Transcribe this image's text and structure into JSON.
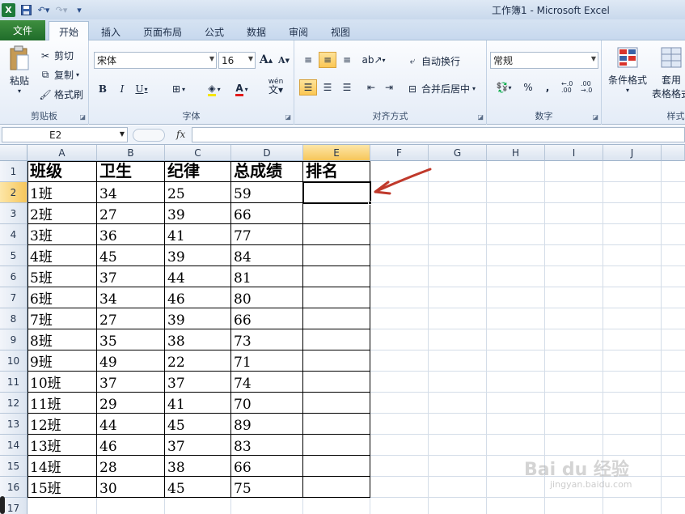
{
  "window": {
    "title": "工作簿1 - Microsoft Excel"
  },
  "tabs": {
    "file": "文件",
    "items": [
      "开始",
      "插入",
      "页面布局",
      "公式",
      "数据",
      "审阅",
      "视图"
    ]
  },
  "ribbon": {
    "clipboard": {
      "label": "剪贴板",
      "paste": "粘贴",
      "cut": "剪切",
      "copy": "复制",
      "format_painter": "格式刷"
    },
    "font": {
      "label": "字体",
      "name": "宋体",
      "size": "16",
      "bold": "B",
      "italic": "I",
      "underline": "U",
      "grow": "A",
      "shrink": "A",
      "wen": "wén"
    },
    "alignment": {
      "label": "对齐方式",
      "wrap": "自动换行",
      "merge": "合并后居中"
    },
    "number": {
      "label": "数字",
      "format": "常规",
      "percent": "%",
      "comma": ",",
      "inc_decimal": "←.0 .00",
      "dec_decimal": ".00 →.0"
    },
    "styles": {
      "conditional": "条件格式",
      "table": "套用\n表格格式",
      "table_1": "套用",
      "table_2": "表格格式",
      "cell_styles": "样式"
    }
  },
  "formula_bar": {
    "name_box": "E2",
    "fx": "fx",
    "value": ""
  },
  "grid": {
    "columns": [
      "A",
      "B",
      "C",
      "D",
      "E",
      "F",
      "G",
      "H",
      "I",
      "J"
    ],
    "rows": [
      "1",
      "2",
      "3",
      "4",
      "5",
      "6",
      "7",
      "8",
      "9",
      "10",
      "11",
      "12",
      "13",
      "14",
      "15",
      "16",
      "17"
    ],
    "selected": "E2",
    "header": [
      "班级",
      "卫生",
      "纪律",
      "总成绩",
      "排名"
    ],
    "data": [
      [
        "1班",
        "34",
        "25",
        "59",
        ""
      ],
      [
        "2班",
        "27",
        "39",
        "66",
        ""
      ],
      [
        "3班",
        "36",
        "41",
        "77",
        ""
      ],
      [
        "4班",
        "45",
        "39",
        "84",
        ""
      ],
      [
        "5班",
        "37",
        "44",
        "81",
        ""
      ],
      [
        "6班",
        "34",
        "46",
        "80",
        ""
      ],
      [
        "7班",
        "27",
        "39",
        "66",
        ""
      ],
      [
        "8班",
        "35",
        "38",
        "73",
        ""
      ],
      [
        "9班",
        "49",
        "22",
        "71",
        ""
      ],
      [
        "10班",
        "37",
        "37",
        "74",
        ""
      ],
      [
        "11班",
        "29",
        "41",
        "70",
        ""
      ],
      [
        "12班",
        "44",
        "45",
        "89",
        ""
      ],
      [
        "13班",
        "46",
        "37",
        "83",
        ""
      ],
      [
        "14班",
        "28",
        "38",
        "66",
        ""
      ],
      [
        "15班",
        "30",
        "45",
        "75",
        ""
      ]
    ]
  },
  "watermark": {
    "main": "Bai du 经验",
    "sub": "jingyan.baidu.com"
  },
  "colors": {
    "file_tab": "#1f6c2a",
    "selection": "#f6c65a",
    "arrow": "#c0392b"
  }
}
